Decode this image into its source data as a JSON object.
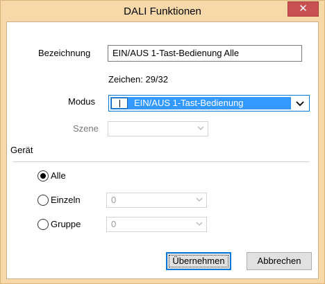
{
  "window": {
    "title": "DALI Funktionen",
    "close_glyph": "✕",
    "titlebar_color": "#f7d9a9",
    "close_color": "#c75050"
  },
  "form": {
    "bezeichnung_label": "Bezeichnung",
    "bezeichnung_value": "EIN/AUS 1-Tast-Bedienung Alle",
    "zeichen_text": "Zeichen: 29/32",
    "modus_label": "Modus",
    "modus_value": "EIN/AUS 1-Tast-Bedienung",
    "szene_label": "Szene",
    "szene_value": ""
  },
  "geraet": {
    "label": "Gerät",
    "options": [
      {
        "label": "Alle",
        "selected": true,
        "value": ""
      },
      {
        "label": "Einzeln",
        "selected": false,
        "value": "0"
      },
      {
        "label": "Gruppe",
        "selected": false,
        "value": "0"
      }
    ]
  },
  "buttons": {
    "apply_label": "Übernehmen",
    "cancel_label": "Abbrechen"
  },
  "icons": {
    "chevron": "chevron-down-icon",
    "close": "close-icon"
  },
  "colors": {
    "selection": "#3399ff",
    "focus_border": "#0078d7"
  }
}
